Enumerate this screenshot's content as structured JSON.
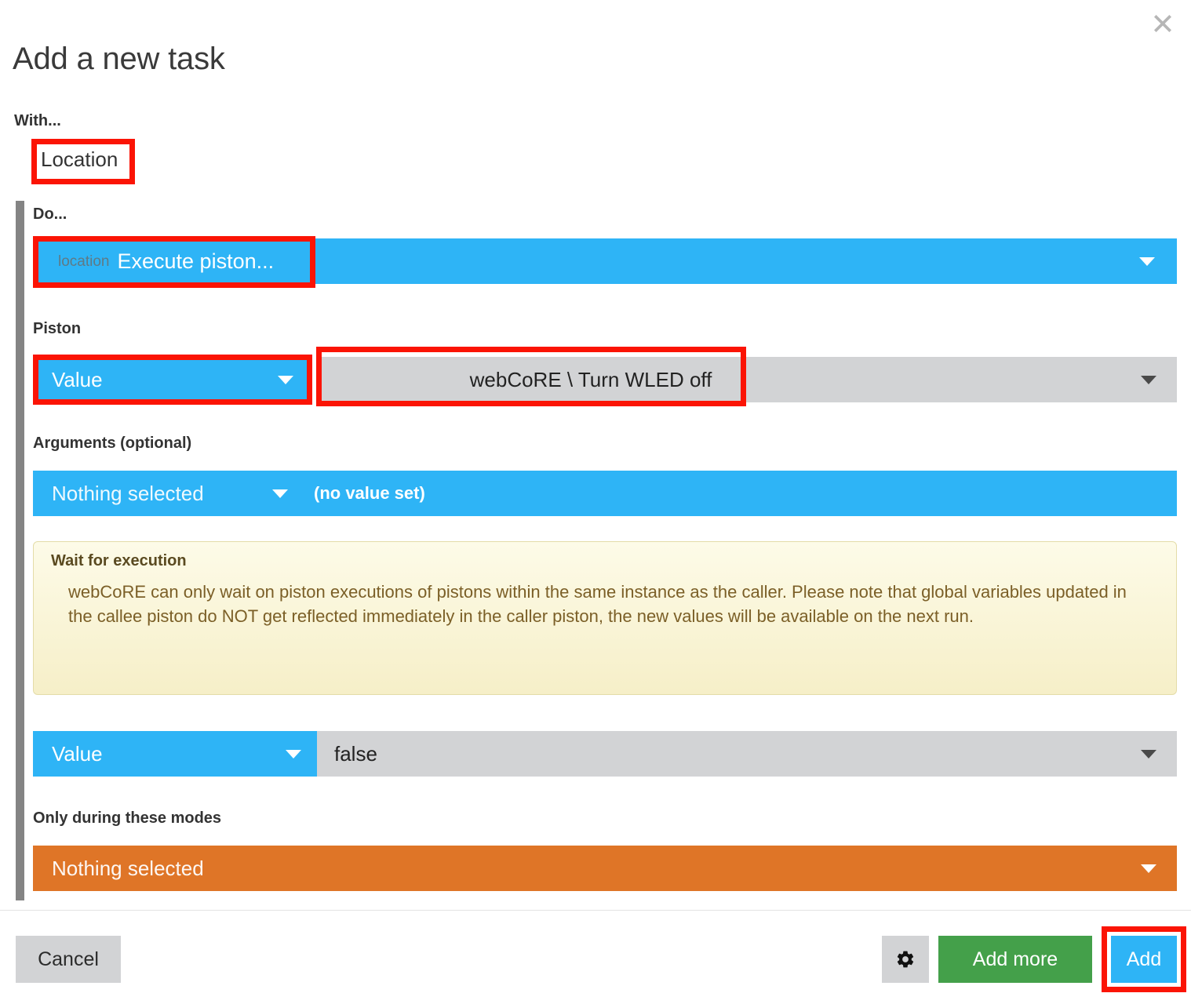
{
  "dialog": {
    "title": "Add a new task",
    "close_icon": "close-icon"
  },
  "with_section": {
    "label": "With...",
    "value": "Location"
  },
  "do_section": {
    "label": "Do...",
    "prefix": "location",
    "value": "Execute piston...",
    "caret_icon": "chevron-down-icon"
  },
  "piston_section": {
    "label": "Piston",
    "mode": "Value",
    "selected": "webCoRE \\ Turn WLED off",
    "caret_icon": "chevron-down-icon"
  },
  "arguments_section": {
    "label": "Arguments (optional)",
    "selection": "Nothing selected",
    "value_note": "(no value set)",
    "caret_icon": "chevron-down-icon"
  },
  "warning": {
    "title": "Wait for execution",
    "text": "webCoRE can only wait on piston executions of pistons within the same instance as the caller. Please note that global variables updated in the callee piston do NOT get reflected immediately in the caller piston, the new values will be available on the next run."
  },
  "wait_value_section": {
    "mode": "Value",
    "value": "false",
    "caret_icon": "chevron-down-icon"
  },
  "modes_section": {
    "label": "Only during these modes",
    "value": "Nothing selected",
    "caret_icon": "chevron-down-icon"
  },
  "footer": {
    "cancel_label": "Cancel",
    "gear_icon": "gear-icon",
    "add_more_label": "Add more",
    "add_label": "Add"
  },
  "colors": {
    "accent_blue": "#2eb4f6",
    "green": "#44a04a",
    "orange": "#df7527",
    "gray_control": "#d2d3d5",
    "rail_gray": "#848484",
    "highlight_red": "#fb1405",
    "warning_bg": "#f6efc8",
    "warning_text": "#7b5f27"
  }
}
